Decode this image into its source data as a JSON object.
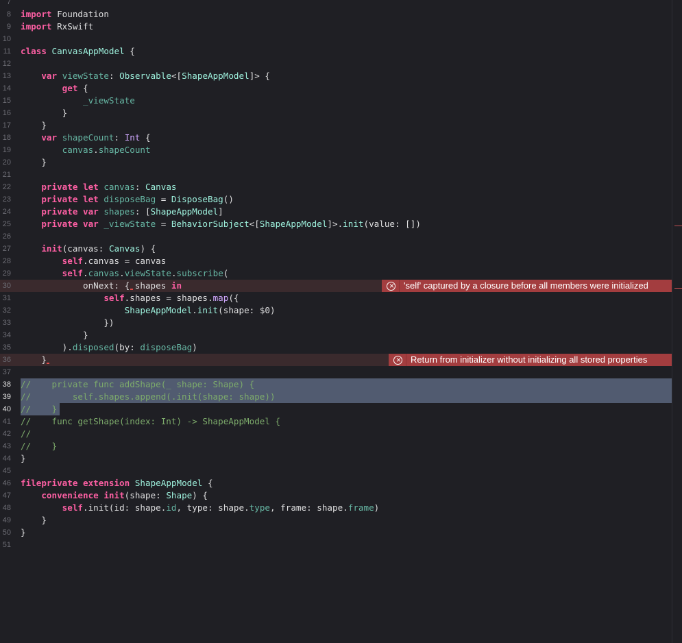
{
  "editor": {
    "lines": [
      {
        "n": "7",
        "tokens": []
      },
      {
        "n": "8",
        "tokens": [
          {
            "c": "kw",
            "t": "import"
          },
          {
            "c": "pl",
            "t": " Foundation"
          }
        ]
      },
      {
        "n": "9",
        "tokens": [
          {
            "c": "kw",
            "t": "import"
          },
          {
            "c": "pl",
            "t": " RxSwift"
          }
        ]
      },
      {
        "n": "10",
        "tokens": []
      },
      {
        "n": "11",
        "tokens": [
          {
            "c": "kw",
            "t": "class"
          },
          {
            "c": "pl",
            "t": " "
          },
          {
            "c": "ty",
            "t": "CanvasAppModel"
          },
          {
            "c": "pl",
            "t": " {"
          }
        ]
      },
      {
        "n": "12",
        "tokens": []
      },
      {
        "n": "13",
        "tokens": [
          {
            "c": "pl",
            "t": "    "
          },
          {
            "c": "kw",
            "t": "var"
          },
          {
            "c": "pl",
            "t": " "
          },
          {
            "c": "prop",
            "t": "viewState"
          },
          {
            "c": "pl",
            "t": ": "
          },
          {
            "c": "ty",
            "t": "Observable"
          },
          {
            "c": "pl",
            "t": "<["
          },
          {
            "c": "ty",
            "t": "ShapeAppModel"
          },
          {
            "c": "pl",
            "t": "]> {"
          }
        ]
      },
      {
        "n": "14",
        "tokens": [
          {
            "c": "pl",
            "t": "        "
          },
          {
            "c": "kw",
            "t": "get"
          },
          {
            "c": "pl",
            "t": " {"
          }
        ]
      },
      {
        "n": "15",
        "tokens": [
          {
            "c": "pl",
            "t": "            "
          },
          {
            "c": "prop",
            "t": "_viewState"
          }
        ]
      },
      {
        "n": "16",
        "tokens": [
          {
            "c": "pl",
            "t": "        }"
          }
        ]
      },
      {
        "n": "17",
        "tokens": [
          {
            "c": "pl",
            "t": "    }"
          }
        ]
      },
      {
        "n": "18",
        "tokens": [
          {
            "c": "pl",
            "t": "    "
          },
          {
            "c": "kw",
            "t": "var"
          },
          {
            "c": "pl",
            "t": " "
          },
          {
            "c": "prop",
            "t": "shapeCount"
          },
          {
            "c": "pl",
            "t": ": "
          },
          {
            "c": "ty2",
            "t": "Int"
          },
          {
            "c": "pl",
            "t": " {"
          }
        ]
      },
      {
        "n": "19",
        "tokens": [
          {
            "c": "pl",
            "t": "        "
          },
          {
            "c": "prop",
            "t": "canvas"
          },
          {
            "c": "pl",
            "t": "."
          },
          {
            "c": "prop",
            "t": "shapeCount"
          }
        ]
      },
      {
        "n": "20",
        "tokens": [
          {
            "c": "pl",
            "t": "    }"
          }
        ]
      },
      {
        "n": "21",
        "tokens": []
      },
      {
        "n": "22",
        "tokens": [
          {
            "c": "pl",
            "t": "    "
          },
          {
            "c": "kw",
            "t": "private let"
          },
          {
            "c": "pl",
            "t": " "
          },
          {
            "c": "prop",
            "t": "canvas"
          },
          {
            "c": "pl",
            "t": ": "
          },
          {
            "c": "ty",
            "t": "Canvas"
          }
        ]
      },
      {
        "n": "23",
        "tokens": [
          {
            "c": "pl",
            "t": "    "
          },
          {
            "c": "kw",
            "t": "private let"
          },
          {
            "c": "pl",
            "t": " "
          },
          {
            "c": "prop",
            "t": "disposeBag"
          },
          {
            "c": "pl",
            "t": " = "
          },
          {
            "c": "ty",
            "t": "DisposeBag"
          },
          {
            "c": "pl",
            "t": "()"
          }
        ]
      },
      {
        "n": "24",
        "tokens": [
          {
            "c": "pl",
            "t": "    "
          },
          {
            "c": "kw",
            "t": "private var"
          },
          {
            "c": "pl",
            "t": " "
          },
          {
            "c": "prop",
            "t": "shapes"
          },
          {
            "c": "pl",
            "t": ": ["
          },
          {
            "c": "ty",
            "t": "ShapeAppModel"
          },
          {
            "c": "pl",
            "t": "]"
          }
        ]
      },
      {
        "n": "25",
        "tokens": [
          {
            "c": "pl",
            "t": "    "
          },
          {
            "c": "kw",
            "t": "private var"
          },
          {
            "c": "pl",
            "t": " "
          },
          {
            "c": "prop",
            "t": "_viewState"
          },
          {
            "c": "pl",
            "t": " = "
          },
          {
            "c": "ty",
            "t": "BehaviorSubject"
          },
          {
            "c": "pl",
            "t": "<["
          },
          {
            "c": "ty",
            "t": "ShapeAppModel"
          },
          {
            "c": "pl",
            "t": "]>."
          },
          {
            "c": "ty",
            "t": "init"
          },
          {
            "c": "pl",
            "t": "(value: [])"
          }
        ]
      },
      {
        "n": "26",
        "tokens": []
      },
      {
        "n": "27",
        "tokens": [
          {
            "c": "pl",
            "t": "    "
          },
          {
            "c": "kw",
            "t": "init"
          },
          {
            "c": "pl",
            "t": "(canvas: "
          },
          {
            "c": "ty",
            "t": "Canvas"
          },
          {
            "c": "pl",
            "t": ") {"
          }
        ]
      },
      {
        "n": "28",
        "tokens": [
          {
            "c": "pl",
            "t": "        "
          },
          {
            "c": "kw",
            "t": "self"
          },
          {
            "c": "pl",
            "t": ".canvas = canvas"
          }
        ]
      },
      {
        "n": "29",
        "tokens": [
          {
            "c": "pl",
            "t": "        "
          },
          {
            "c": "kw",
            "t": "self"
          },
          {
            "c": "pl",
            "t": "."
          },
          {
            "c": "prop",
            "t": "canvas"
          },
          {
            "c": "pl",
            "t": "."
          },
          {
            "c": "prop",
            "t": "viewState"
          },
          {
            "c": "pl",
            "t": "."
          },
          {
            "c": "prop",
            "t": "subscribe"
          },
          {
            "c": "pl",
            "t": "("
          }
        ]
      },
      {
        "n": "30",
        "err": true,
        "tokens": [
          {
            "c": "pl",
            "t": "            onNext: { shapes "
          },
          {
            "c": "kw",
            "t": "in"
          }
        ]
      },
      {
        "n": "31",
        "tokens": [
          {
            "c": "pl",
            "t": "                "
          },
          {
            "c": "kw",
            "t": "self"
          },
          {
            "c": "pl",
            "t": ".shapes = shapes."
          },
          {
            "c": "ty2",
            "t": "map"
          },
          {
            "c": "pl",
            "t": "({"
          }
        ]
      },
      {
        "n": "32",
        "tokens": [
          {
            "c": "pl",
            "t": "                    "
          },
          {
            "c": "ty",
            "t": "ShapeAppModel"
          },
          {
            "c": "pl",
            "t": "."
          },
          {
            "c": "ty",
            "t": "init"
          },
          {
            "c": "pl",
            "t": "(shape: $0)"
          }
        ]
      },
      {
        "n": "33",
        "tokens": [
          {
            "c": "pl",
            "t": "                })"
          }
        ]
      },
      {
        "n": "34",
        "tokens": [
          {
            "c": "pl",
            "t": "            }"
          }
        ]
      },
      {
        "n": "35",
        "tokens": [
          {
            "c": "pl",
            "t": "        )."
          },
          {
            "c": "prop",
            "t": "disposed"
          },
          {
            "c": "pl",
            "t": "(by: "
          },
          {
            "c": "prop",
            "t": "disposeBag"
          },
          {
            "c": "pl",
            "t": ")"
          }
        ]
      },
      {
        "n": "36",
        "err": true,
        "tokens": [
          {
            "c": "pl",
            "t": "    }"
          }
        ]
      },
      {
        "n": "37",
        "tokens": []
      },
      {
        "n": "38",
        "sel": true,
        "tokens": [
          {
            "c": "cm",
            "t": "//    private func addShape(_ shape: Shape) {"
          }
        ]
      },
      {
        "n": "39",
        "sel": true,
        "tokens": [
          {
            "c": "cm",
            "t": "//        self.shapes.append(.init(shape: shape))"
          }
        ]
      },
      {
        "n": "40",
        "selPartial": true,
        "tokens": [
          {
            "c": "cm",
            "t": "//    }"
          }
        ]
      },
      {
        "n": "41",
        "tokens": [
          {
            "c": "cm",
            "t": "//    func getShape(index: Int) -> ShapeAppModel {"
          }
        ]
      },
      {
        "n": "42",
        "tokens": [
          {
            "c": "cm",
            "t": "//"
          }
        ]
      },
      {
        "n": "43",
        "tokens": [
          {
            "c": "cm",
            "t": "//    }"
          }
        ]
      },
      {
        "n": "44",
        "tokens": [
          {
            "c": "pl",
            "t": "}"
          }
        ]
      },
      {
        "n": "45",
        "tokens": []
      },
      {
        "n": "46",
        "tokens": [
          {
            "c": "kw",
            "t": "fileprivate extension"
          },
          {
            "c": "pl",
            "t": " "
          },
          {
            "c": "ty",
            "t": "ShapeAppModel"
          },
          {
            "c": "pl",
            "t": " {"
          }
        ]
      },
      {
        "n": "47",
        "tokens": [
          {
            "c": "pl",
            "t": "    "
          },
          {
            "c": "kw",
            "t": "convenience init"
          },
          {
            "c": "pl",
            "t": "(shape: "
          },
          {
            "c": "ty",
            "t": "Shape"
          },
          {
            "c": "pl",
            "t": ") {"
          }
        ]
      },
      {
        "n": "48",
        "tokens": [
          {
            "c": "pl",
            "t": "        "
          },
          {
            "c": "kw",
            "t": "self"
          },
          {
            "c": "pl",
            "t": ".init(id: shape."
          },
          {
            "c": "prop",
            "t": "id"
          },
          {
            "c": "pl",
            "t": ", type: shape."
          },
          {
            "c": "prop",
            "t": "type"
          },
          {
            "c": "pl",
            "t": ", frame: shape."
          },
          {
            "c": "prop",
            "t": "frame"
          },
          {
            "c": "pl",
            "t": ")"
          }
        ]
      },
      {
        "n": "49",
        "tokens": [
          {
            "c": "pl",
            "t": "    }"
          }
        ]
      },
      {
        "n": "50",
        "tokens": [
          {
            "c": "pl",
            "t": "}"
          }
        ]
      },
      {
        "n": "51",
        "tokens": []
      }
    ]
  },
  "errors": {
    "e1": "'self' captured by a closure before all members were initialized",
    "e2": "Return from initializer without initializing all stored properties"
  },
  "colors": {
    "background": "#1f1f24",
    "keyword": "#fc5fa3",
    "type": "#9ef1dd",
    "property": "#67b7a4",
    "comment": "#7dab6b",
    "error": "#a33d3f",
    "selection": "#515b70"
  }
}
